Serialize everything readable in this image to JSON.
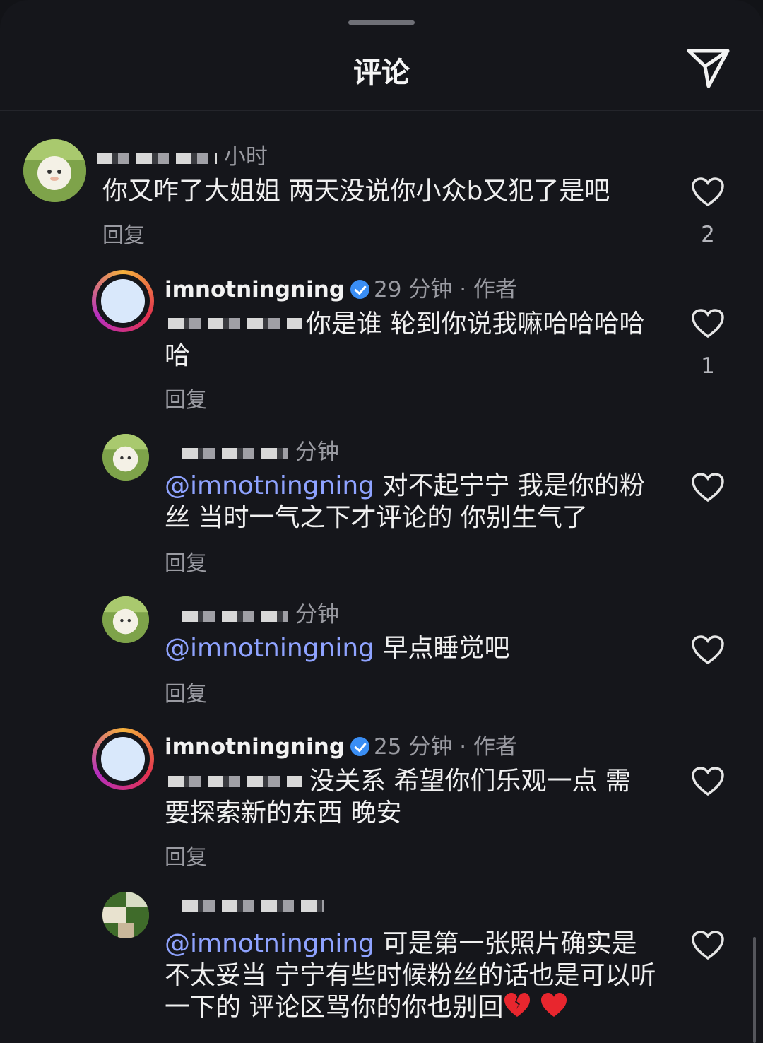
{
  "header": {
    "title": "评论"
  },
  "comments": [
    {
      "username": "",
      "time": "小时",
      "text": "你又咋了大姐姐 两天没说你小众b又犯了是吧",
      "reply_label": "回复",
      "likes": "2"
    },
    {
      "username": "imnotningning",
      "time": "29 分钟",
      "author_tag": "作者",
      "text": "你是谁 轮到你说我嘛哈哈哈哈哈",
      "reply_label": "回复",
      "likes": "1"
    },
    {
      "username": "",
      "time": "分钟",
      "mention": "@imnotningning",
      "text": "对不起宁宁 我是你的粉丝 当时一气之下才评论的 你别生气了",
      "reply_label": "回复"
    },
    {
      "username": "",
      "time": "分钟",
      "mention": "@imnotningning",
      "text": "早点睡觉吧",
      "reply_label": "回复"
    },
    {
      "username": "imnotningning",
      "time": "25 分钟",
      "author_tag": "作者",
      "text": "没关系 希望你们乐观一点 需要探索新的东西 晚安",
      "reply_label": "回复"
    },
    {
      "username": "",
      "time": "",
      "mention": "@imnotningning",
      "text": "可是第一张照片确实是不太妥当 宁宁有些时候粉丝的话也是可以听一下的 评论区骂你的你也别回"
    }
  ],
  "colors": {
    "background": "#15161b",
    "mention": "#8fa3ff",
    "verified": "#3a8ef5",
    "heart_emoji": "#e8262e"
  },
  "icons": [
    "send-icon",
    "heart-icon",
    "verified-badge-icon",
    "broken-heart-emoji"
  ]
}
